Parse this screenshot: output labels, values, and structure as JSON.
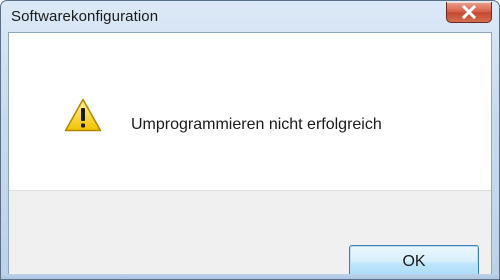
{
  "window": {
    "title": "Softwarekonfiguration"
  },
  "dialog": {
    "message": "Umprogrammieren nicht erfolgreich",
    "icon": "warning-icon"
  },
  "buttons": {
    "ok_label": "OK",
    "close_icon": "close-icon"
  },
  "colors": {
    "close_button": "#c44a30",
    "ok_button_border": "#3c7fb1",
    "footer_background": "#f0f0f0",
    "warning_fill": "#f7d000"
  }
}
